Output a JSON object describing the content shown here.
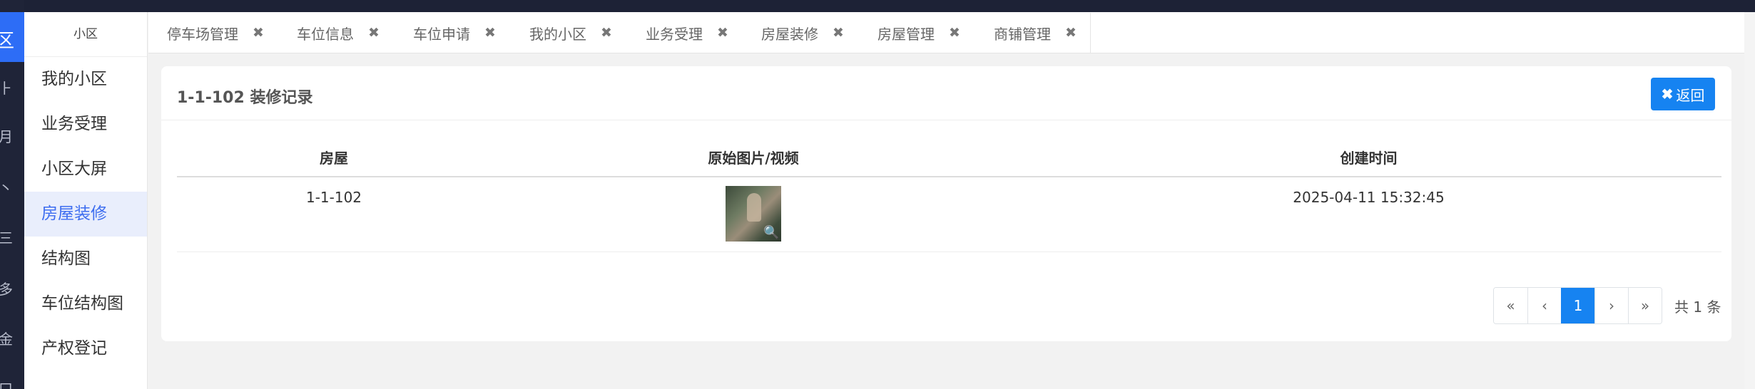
{
  "rail": {
    "active_char": "区",
    "glyphs": [
      "⺊",
      "月",
      "丶",
      "三",
      "多",
      "金",
      "口"
    ]
  },
  "sidebar": {
    "header": "小区",
    "items": [
      {
        "label": "我的小区",
        "active": false
      },
      {
        "label": "业务受理",
        "active": false
      },
      {
        "label": "小区大屏",
        "active": false
      },
      {
        "label": "房屋装修",
        "active": true
      },
      {
        "label": "结构图",
        "active": false
      },
      {
        "label": "车位结构图",
        "active": false
      },
      {
        "label": "产权登记",
        "active": false
      }
    ]
  },
  "tabs": [
    {
      "label": "停车场管理"
    },
    {
      "label": "车位信息"
    },
    {
      "label": "车位申请"
    },
    {
      "label": "我的小区"
    },
    {
      "label": "业务受理"
    },
    {
      "label": "房屋装修"
    },
    {
      "label": "房屋管理"
    },
    {
      "label": "商铺管理"
    }
  ],
  "tab_close_glyph": "✖",
  "panel": {
    "title": "1-1-102 装修记录",
    "back_icon": "✖",
    "back_label": "返回"
  },
  "table": {
    "headers": [
      "房屋",
      "原始图片/视频",
      "创建时间"
    ],
    "rows": [
      {
        "house": "1-1-102",
        "media_icon": "magnifier-icon",
        "created": "2025-04-11 15:32:45"
      }
    ]
  },
  "pagination": {
    "first": "«",
    "prev": "‹",
    "current": "1",
    "next": "›",
    "last": "»",
    "total": "共 1 条"
  },
  "colors": {
    "accent": "#1683f1",
    "rail": "#1f2438",
    "rail_active": "#2d6df6",
    "menu_active_bg": "#e9eefc",
    "menu_active_text": "#3e6ef0"
  }
}
